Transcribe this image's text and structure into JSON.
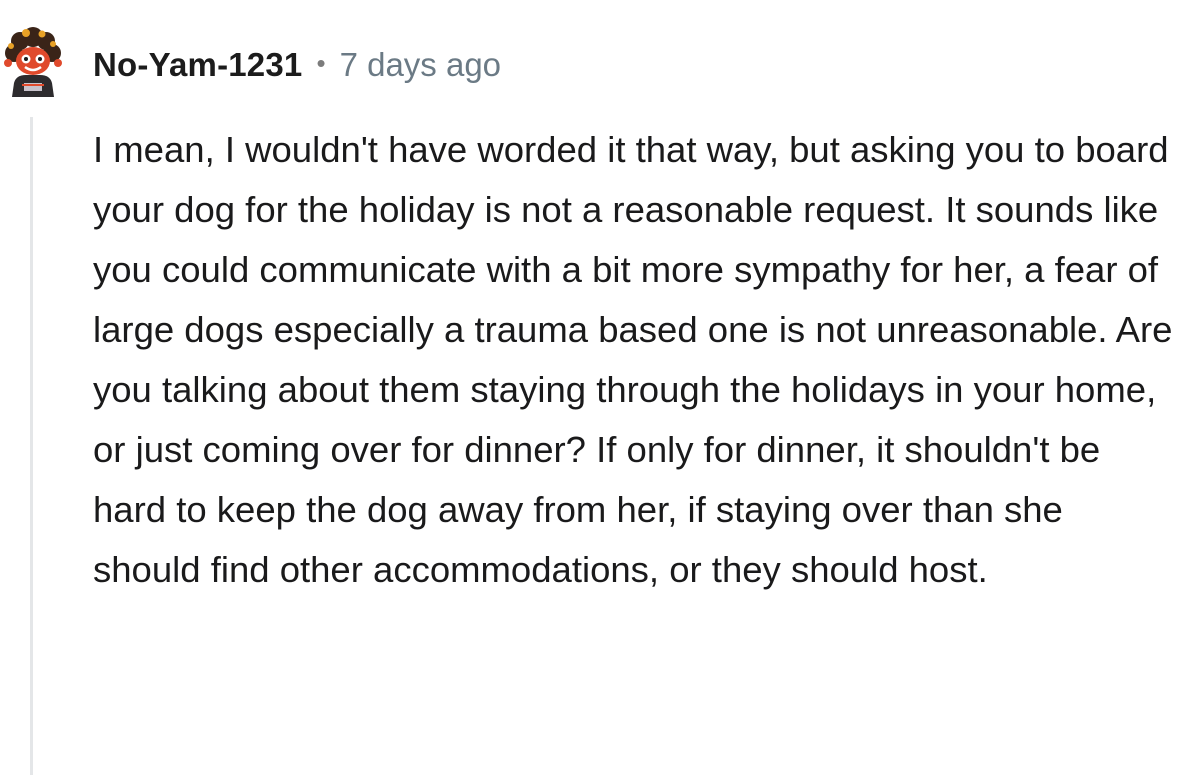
{
  "comment": {
    "username": "No-Yam-1231",
    "separator": "•",
    "timestamp": "7 days ago",
    "body": "I mean, I wouldn't have worded it that way, but asking you to board your dog for the holiday is not a reasonable request. It sounds like you could communicate with a bit more sympathy for her, a fear of large dogs especially a trauma based one is not unreasonable. Are you talking about them staying through the holidays in your home, or just coming over for dinner? If only for dinner, it shouldn't be hard to keep the dog away from her, if staying over than she should find other accommodations, or they should host."
  },
  "avatar": {
    "icon": "snoo-avatar-icon",
    "colors": {
      "hair": "#3a2418",
      "accent": "#e8a126",
      "face": "#e04a2c",
      "shirt": "#2d2b2e"
    }
  },
  "colors": {
    "username": "#1c1c1c",
    "timestamp": "#6b7a85",
    "body": "#1a1a1b",
    "thread_line": "#e4e6e8"
  }
}
